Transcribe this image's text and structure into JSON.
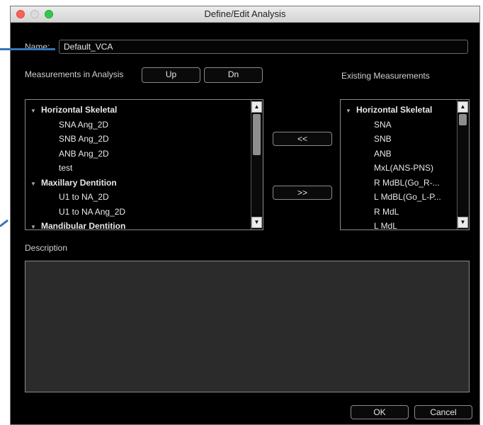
{
  "window": {
    "title": "Define/Edit Analysis"
  },
  "name": {
    "label": "Name:",
    "value": "Default_VCA"
  },
  "analysis": {
    "label": "Measurements in Analysis",
    "up_label": "Up",
    "down_label": "Dn",
    "items": [
      {
        "text": "Horizontal Skeletal",
        "group": true
      },
      {
        "text": "SNA Ang_2D",
        "group": false
      },
      {
        "text": "SNB Ang_2D",
        "group": false
      },
      {
        "text": "ANB Ang_2D",
        "group": false
      },
      {
        "text": "test",
        "group": false
      },
      {
        "text": "Maxillary Dentition",
        "group": true
      },
      {
        "text": "U1 to NA_2D",
        "group": false
      },
      {
        "text": "U1 to NA Ang_2D",
        "group": false
      },
      {
        "text": "Mandibular Dentition",
        "group": true
      }
    ]
  },
  "transfer": {
    "remove_label": "<<",
    "add_label": ">>"
  },
  "existing": {
    "label": "Existing Measurements",
    "items": [
      {
        "text": "Horizontal Skeletal",
        "group": true
      },
      {
        "text": "SNA",
        "group": false
      },
      {
        "text": "SNB",
        "group": false
      },
      {
        "text": "ANB",
        "group": false
      },
      {
        "text": "MxL(ANS-PNS)",
        "group": false
      },
      {
        "text": "R MdBL(Go_R-...",
        "group": false
      },
      {
        "text": "L MdBL(Go_L-P...",
        "group": false
      },
      {
        "text": "R MdL",
        "group": false
      },
      {
        "text": "L MdL",
        "group": false
      }
    ]
  },
  "description": {
    "label": "Description",
    "value": ""
  },
  "footer": {
    "ok_label": "OK",
    "cancel_label": "Cancel"
  },
  "icons": {
    "expand": "triangle-down-icon",
    "scroll_up": "triangle-up-icon",
    "scroll_down": "triangle-down-icon"
  },
  "colors": {
    "background": "#000000",
    "text": "#e8e8e8",
    "callout": "#3a73b3"
  }
}
